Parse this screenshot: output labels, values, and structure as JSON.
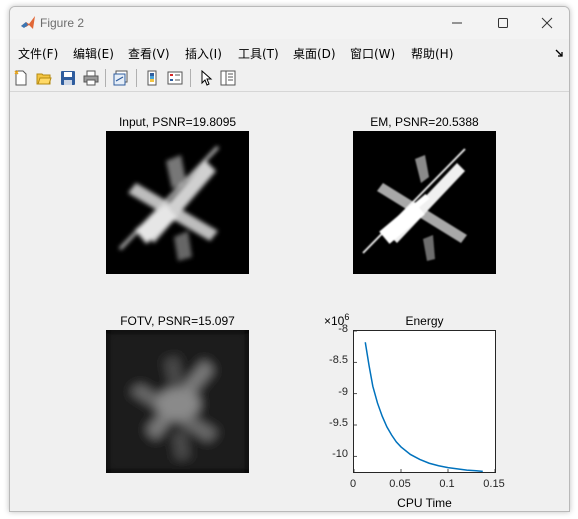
{
  "window": {
    "title": "Figure 2",
    "minimize_icon": "minimize-icon",
    "maximize_icon": "maximize-icon",
    "close_icon": "close-icon"
  },
  "menu": {
    "items": [
      "文件(F)",
      "编辑(E)",
      "查看(V)",
      "插入(I)",
      "工具(T)",
      "桌面(D)",
      "窗口(W)",
      "帮助(H)"
    ],
    "dock_icon": "dock-arrow-icon"
  },
  "toolbar": {
    "icons": [
      "new-figure-icon",
      "open-file-icon",
      "save-icon",
      "print-icon",
      "link-plot-icon",
      "colorbar-icon",
      "legend-icon",
      "edit-plot-arrow-icon",
      "property-inspector-icon"
    ]
  },
  "plots": {
    "input_title": "Input, PSNR=19.8095",
    "em_title": "EM, PSNR=20.5388",
    "fotv_title": "FOTV, PSNR=15.097",
    "energy_title": "Energy"
  },
  "chart_data": {
    "type": "line",
    "title": "Energy",
    "xlabel": "CPU Time",
    "ylabel": "",
    "y_exponent_label": "×10",
    "y_exponent": "6",
    "xlim": [
      0,
      0.15
    ],
    "ylim": [
      -10.25,
      -8.0
    ],
    "xticks": [
      "0",
      "0.05",
      "0.1",
      "0.15"
    ],
    "yticks": [
      "-8",
      "-8.5",
      "-9",
      "-9.5",
      "-10"
    ],
    "xtick_values": [
      0,
      0.05,
      0.1,
      0.15
    ],
    "ytick_values": [
      -8,
      -8.5,
      -9,
      -9.5,
      -10
    ],
    "line_color": "#0072bd",
    "grid": false,
    "series": [
      {
        "x": [
          0.012,
          0.016,
          0.02,
          0.025,
          0.03,
          0.035,
          0.04,
          0.045,
          0.05,
          0.06,
          0.07,
          0.08,
          0.09,
          0.1,
          0.11,
          0.12,
          0.13,
          0.137
        ],
        "values": [
          -8.18,
          -8.55,
          -8.88,
          -9.15,
          -9.36,
          -9.53,
          -9.66,
          -9.77,
          -9.85,
          -9.97,
          -10.05,
          -10.11,
          -10.15,
          -10.18,
          -10.2,
          -10.22,
          -10.23,
          -10.24
        ]
      }
    ]
  }
}
